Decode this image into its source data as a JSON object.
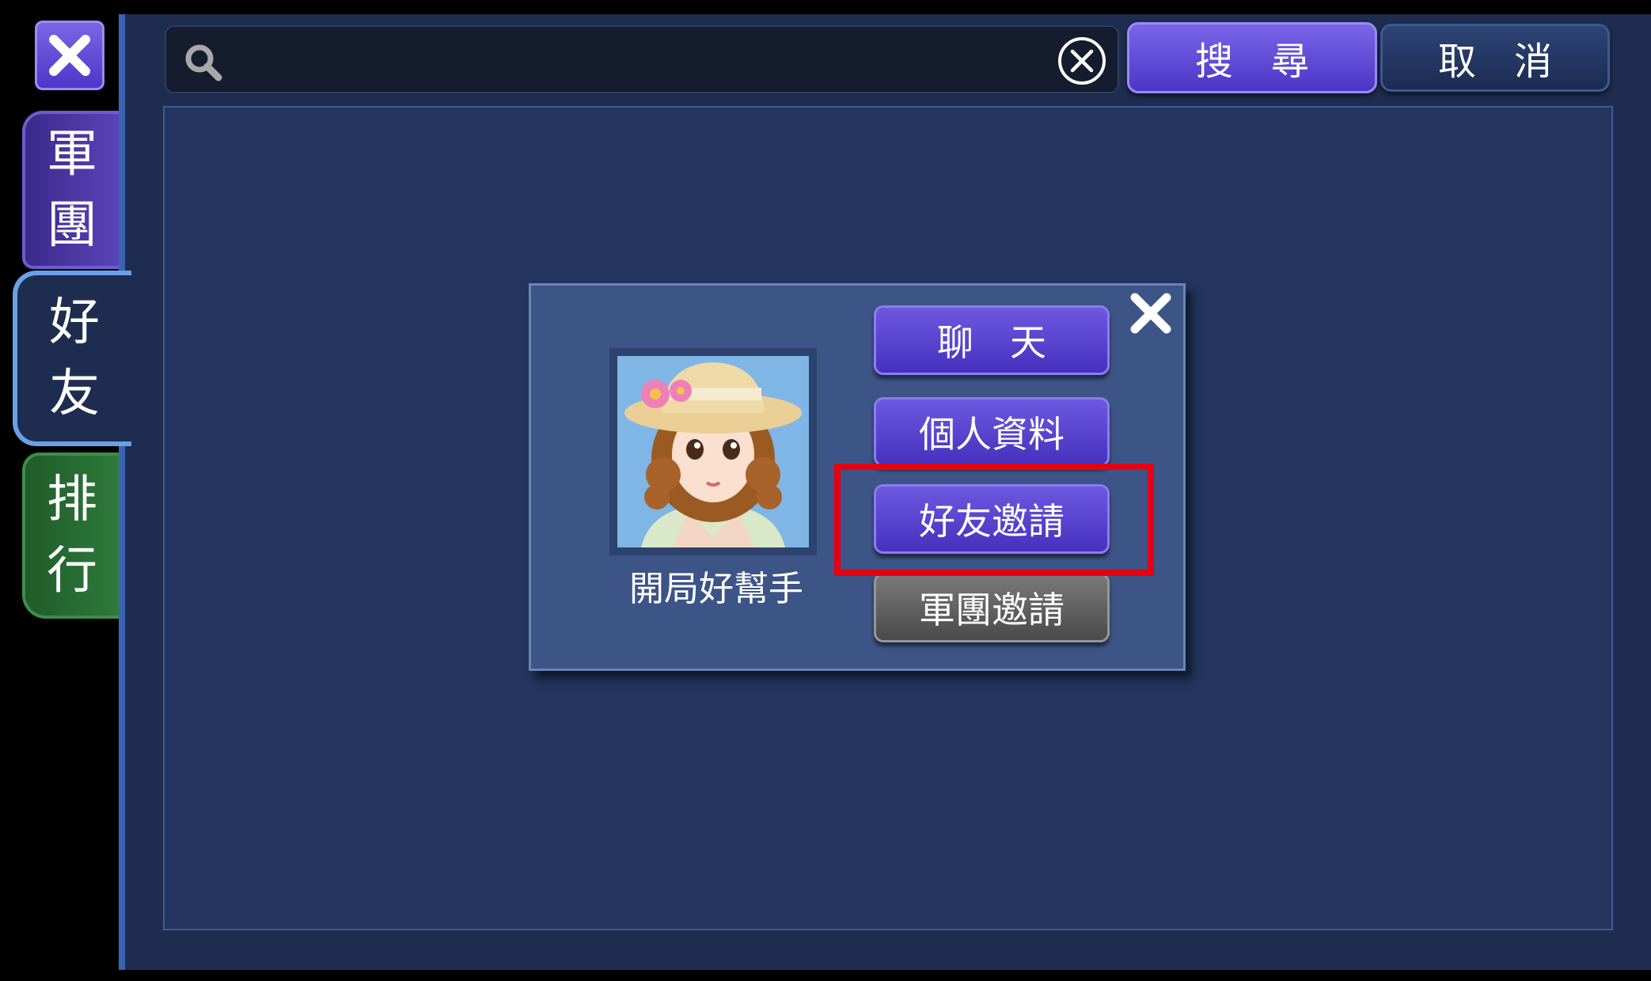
{
  "header": {
    "close_icon": "close-icon",
    "search": {
      "value": "",
      "placeholder": ""
    },
    "search_button": "搜　尋",
    "cancel_button": "取　消"
  },
  "tabs": [
    {
      "id": "army",
      "chars": [
        "軍",
        "團"
      ],
      "color": "#5a44b8"
    },
    {
      "id": "friends",
      "chars": [
        "好",
        "友"
      ],
      "color": "#1e2d4f",
      "selected": true
    },
    {
      "id": "rank",
      "chars": [
        "排",
        "行"
      ],
      "color": "#2e7a3a"
    }
  ],
  "popup": {
    "player_name": "開局好幫手",
    "buttons": {
      "chat": "聊　天",
      "profile": "個人資料",
      "friend_invite": "好友邀請",
      "army_invite": "軍團邀請"
    },
    "highlighted": "friend_invite",
    "highlight_color": "#e60012"
  }
}
